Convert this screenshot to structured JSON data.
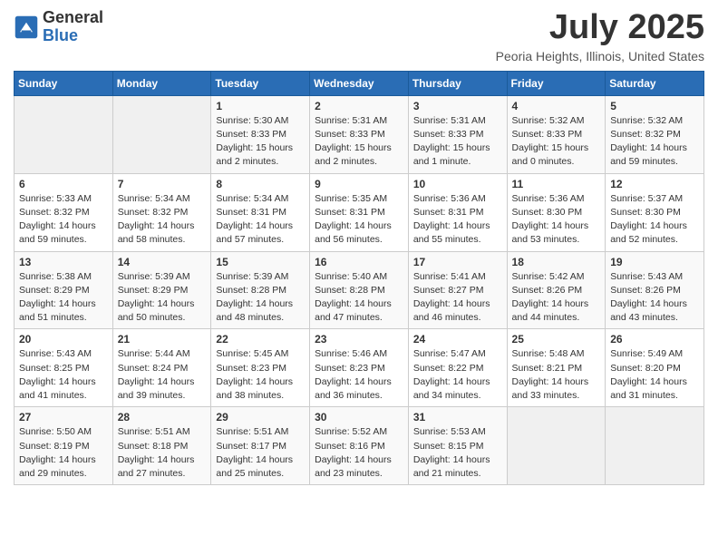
{
  "header": {
    "logo_general": "General",
    "logo_blue": "Blue",
    "month_title": "July 2025",
    "location": "Peoria Heights, Illinois, United States"
  },
  "weekdays": [
    "Sunday",
    "Monday",
    "Tuesday",
    "Wednesday",
    "Thursday",
    "Friday",
    "Saturday"
  ],
  "weeks": [
    [
      {
        "day": "",
        "sunrise": "",
        "sunset": "",
        "daylight": ""
      },
      {
        "day": "",
        "sunrise": "",
        "sunset": "",
        "daylight": ""
      },
      {
        "day": "1",
        "sunrise": "Sunrise: 5:30 AM",
        "sunset": "Sunset: 8:33 PM",
        "daylight": "Daylight: 15 hours and 2 minutes."
      },
      {
        "day": "2",
        "sunrise": "Sunrise: 5:31 AM",
        "sunset": "Sunset: 8:33 PM",
        "daylight": "Daylight: 15 hours and 2 minutes."
      },
      {
        "day": "3",
        "sunrise": "Sunrise: 5:31 AM",
        "sunset": "Sunset: 8:33 PM",
        "daylight": "Daylight: 15 hours and 1 minute."
      },
      {
        "day": "4",
        "sunrise": "Sunrise: 5:32 AM",
        "sunset": "Sunset: 8:33 PM",
        "daylight": "Daylight: 15 hours and 0 minutes."
      },
      {
        "day": "5",
        "sunrise": "Sunrise: 5:32 AM",
        "sunset": "Sunset: 8:32 PM",
        "daylight": "Daylight: 14 hours and 59 minutes."
      }
    ],
    [
      {
        "day": "6",
        "sunrise": "Sunrise: 5:33 AM",
        "sunset": "Sunset: 8:32 PM",
        "daylight": "Daylight: 14 hours and 59 minutes."
      },
      {
        "day": "7",
        "sunrise": "Sunrise: 5:34 AM",
        "sunset": "Sunset: 8:32 PM",
        "daylight": "Daylight: 14 hours and 58 minutes."
      },
      {
        "day": "8",
        "sunrise": "Sunrise: 5:34 AM",
        "sunset": "Sunset: 8:31 PM",
        "daylight": "Daylight: 14 hours and 57 minutes."
      },
      {
        "day": "9",
        "sunrise": "Sunrise: 5:35 AM",
        "sunset": "Sunset: 8:31 PM",
        "daylight": "Daylight: 14 hours and 56 minutes."
      },
      {
        "day": "10",
        "sunrise": "Sunrise: 5:36 AM",
        "sunset": "Sunset: 8:31 PM",
        "daylight": "Daylight: 14 hours and 55 minutes."
      },
      {
        "day": "11",
        "sunrise": "Sunrise: 5:36 AM",
        "sunset": "Sunset: 8:30 PM",
        "daylight": "Daylight: 14 hours and 53 minutes."
      },
      {
        "day": "12",
        "sunrise": "Sunrise: 5:37 AM",
        "sunset": "Sunset: 8:30 PM",
        "daylight": "Daylight: 14 hours and 52 minutes."
      }
    ],
    [
      {
        "day": "13",
        "sunrise": "Sunrise: 5:38 AM",
        "sunset": "Sunset: 8:29 PM",
        "daylight": "Daylight: 14 hours and 51 minutes."
      },
      {
        "day": "14",
        "sunrise": "Sunrise: 5:39 AM",
        "sunset": "Sunset: 8:29 PM",
        "daylight": "Daylight: 14 hours and 50 minutes."
      },
      {
        "day": "15",
        "sunrise": "Sunrise: 5:39 AM",
        "sunset": "Sunset: 8:28 PM",
        "daylight": "Daylight: 14 hours and 48 minutes."
      },
      {
        "day": "16",
        "sunrise": "Sunrise: 5:40 AM",
        "sunset": "Sunset: 8:28 PM",
        "daylight": "Daylight: 14 hours and 47 minutes."
      },
      {
        "day": "17",
        "sunrise": "Sunrise: 5:41 AM",
        "sunset": "Sunset: 8:27 PM",
        "daylight": "Daylight: 14 hours and 46 minutes."
      },
      {
        "day": "18",
        "sunrise": "Sunrise: 5:42 AM",
        "sunset": "Sunset: 8:26 PM",
        "daylight": "Daylight: 14 hours and 44 minutes."
      },
      {
        "day": "19",
        "sunrise": "Sunrise: 5:43 AM",
        "sunset": "Sunset: 8:26 PM",
        "daylight": "Daylight: 14 hours and 43 minutes."
      }
    ],
    [
      {
        "day": "20",
        "sunrise": "Sunrise: 5:43 AM",
        "sunset": "Sunset: 8:25 PM",
        "daylight": "Daylight: 14 hours and 41 minutes."
      },
      {
        "day": "21",
        "sunrise": "Sunrise: 5:44 AM",
        "sunset": "Sunset: 8:24 PM",
        "daylight": "Daylight: 14 hours and 39 minutes."
      },
      {
        "day": "22",
        "sunrise": "Sunrise: 5:45 AM",
        "sunset": "Sunset: 8:23 PM",
        "daylight": "Daylight: 14 hours and 38 minutes."
      },
      {
        "day": "23",
        "sunrise": "Sunrise: 5:46 AM",
        "sunset": "Sunset: 8:23 PM",
        "daylight": "Daylight: 14 hours and 36 minutes."
      },
      {
        "day": "24",
        "sunrise": "Sunrise: 5:47 AM",
        "sunset": "Sunset: 8:22 PM",
        "daylight": "Daylight: 14 hours and 34 minutes."
      },
      {
        "day": "25",
        "sunrise": "Sunrise: 5:48 AM",
        "sunset": "Sunset: 8:21 PM",
        "daylight": "Daylight: 14 hours and 33 minutes."
      },
      {
        "day": "26",
        "sunrise": "Sunrise: 5:49 AM",
        "sunset": "Sunset: 8:20 PM",
        "daylight": "Daylight: 14 hours and 31 minutes."
      }
    ],
    [
      {
        "day": "27",
        "sunrise": "Sunrise: 5:50 AM",
        "sunset": "Sunset: 8:19 PM",
        "daylight": "Daylight: 14 hours and 29 minutes."
      },
      {
        "day": "28",
        "sunrise": "Sunrise: 5:51 AM",
        "sunset": "Sunset: 8:18 PM",
        "daylight": "Daylight: 14 hours and 27 minutes."
      },
      {
        "day": "29",
        "sunrise": "Sunrise: 5:51 AM",
        "sunset": "Sunset: 8:17 PM",
        "daylight": "Daylight: 14 hours and 25 minutes."
      },
      {
        "day": "30",
        "sunrise": "Sunrise: 5:52 AM",
        "sunset": "Sunset: 8:16 PM",
        "daylight": "Daylight: 14 hours and 23 minutes."
      },
      {
        "day": "31",
        "sunrise": "Sunrise: 5:53 AM",
        "sunset": "Sunset: 8:15 PM",
        "daylight": "Daylight: 14 hours and 21 minutes."
      },
      {
        "day": "",
        "sunrise": "",
        "sunset": "",
        "daylight": ""
      },
      {
        "day": "",
        "sunrise": "",
        "sunset": "",
        "daylight": ""
      }
    ]
  ]
}
